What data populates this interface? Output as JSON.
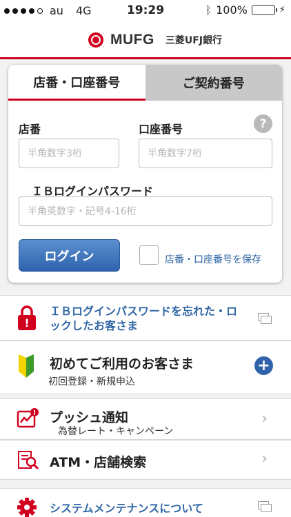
{
  "status_bar": {
    "carrier": "au",
    "network": "4G",
    "time": "19:29",
    "battery": "100%"
  },
  "header": {
    "brand": "MUFG",
    "bank_name": "三菱UFJ銀行"
  },
  "login": {
    "tabs": [
      {
        "label": "店番・口座番号",
        "active": true
      },
      {
        "label": "ご契約番号",
        "active": false
      }
    ],
    "branch_label": "店番",
    "branch_placeholder": "半角数字3桁",
    "account_label": "口座番号",
    "account_placeholder": "半角数字7桁",
    "help": "?",
    "password_label": "ＩＢログインパスワード",
    "password_placeholder": "半角英数字・記号4-16桁",
    "login_button": "ログイン",
    "save_label": "店番・口座番号を保存"
  },
  "menu": {
    "forgot": {
      "title_line1": "ＩＢログインパスワードを忘れた・ロ",
      "title_line2": "ックしたお客さま"
    },
    "first_time": {
      "title": "初めてご利用のお客さま",
      "subtitle": "初回登録・新規申込",
      "plus": "+"
    },
    "push": {
      "title": "プッシュ通知",
      "subtitle": "為替レート・キャンペーン"
    },
    "atm": {
      "title": "ATM・店舗検索"
    },
    "maintenance": {
      "title": "システムメンテナンスについて"
    }
  },
  "colors": {
    "brand_red": "#d0001e",
    "link_blue": "#2f66a6",
    "button_blue": "#2f63ad"
  }
}
